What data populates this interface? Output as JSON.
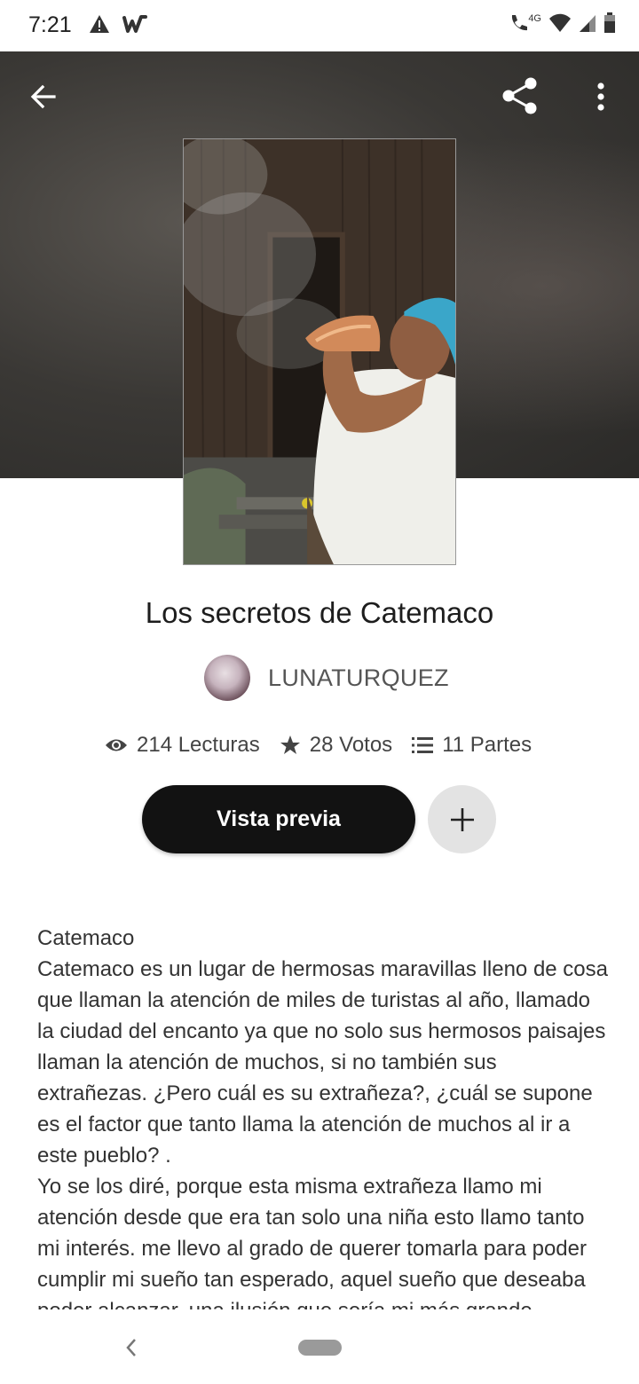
{
  "status_bar": {
    "time": "7:21",
    "left_icons": [
      "warning-icon",
      "wattpad-logo-icon"
    ],
    "right_icons": [
      "wifi-calling-icon",
      "wifi-4g-icon",
      "signal-icon",
      "battery-icon"
    ],
    "network_label": "4G"
  },
  "toolbar": {
    "back_icon": "arrow-left-icon",
    "share_icon": "share-icon",
    "more_icon": "more-vert-icon"
  },
  "story": {
    "title": "Los secretos de Catemaco",
    "author": "LUNATURQUEZ",
    "stats": {
      "reads": "214 Lecturas",
      "votes": "28 Votos",
      "parts": "11 Partes"
    },
    "preview_label": "Vista previa",
    "add_icon": "plus-icon",
    "description": [
      "Catemaco",
      "Catemaco es un lugar de hermosas maravillas lleno de cosa que llaman la atención de miles de turistas al año, llamado la ciudad del encanto ya que no solo sus hermosos paisajes llaman la atención de muchos, si no también sus extrañezas.  ¿Pero cuál es su extrañeza?, ¿cuál se supone es el factor que tanto llama la atención de muchos al ir a este pueblo? .",
      "Yo se los diré, porque esta misma extrañeza llamo mi atención desde que era tan solo una niña esto llamo tanto mi interés. me llevo al grado de querer tomarla para poder cumplir mi sueño tan esperado, aquel sueño que deseaba poder alcanzar, una ilusión que sería mi más grande"
    ]
  },
  "colors": {
    "primary_button": "#121212",
    "secondary_button": "#e3e3e3",
    "turban": "#3aa6c9"
  }
}
